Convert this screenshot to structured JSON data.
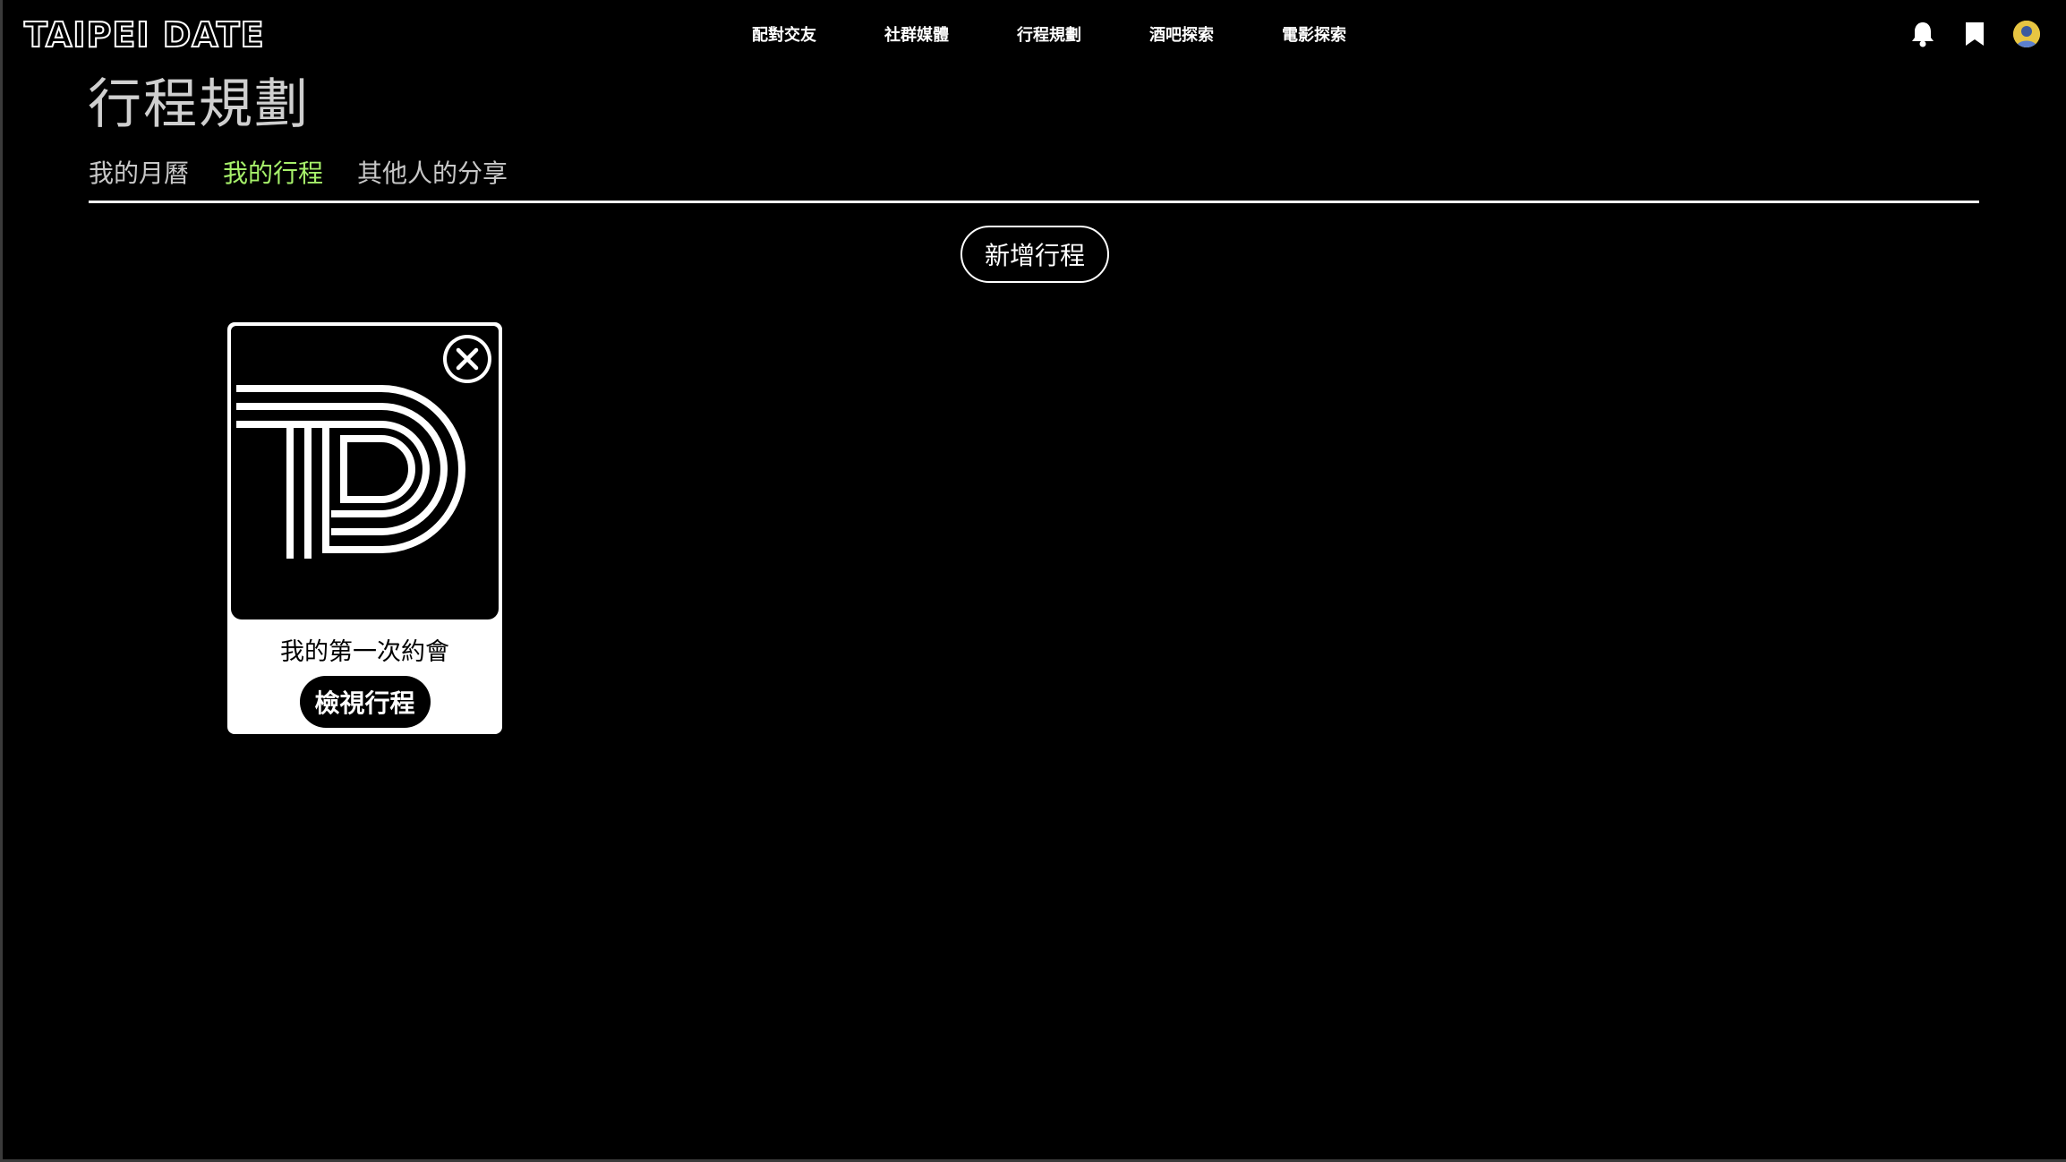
{
  "header": {
    "logo": "TAIPEI DATE",
    "nav": [
      "配對交友",
      "社群媒體",
      "行程規劃",
      "酒吧探索",
      "電影探索"
    ],
    "icons": [
      "bell-icon",
      "bookmark-icon",
      "avatar"
    ]
  },
  "page": {
    "title": "行程規劃",
    "tabs": [
      {
        "label": "我的月曆",
        "active": false
      },
      {
        "label": "我的行程",
        "active": true
      },
      {
        "label": "其他人的分享",
        "active": false
      }
    ],
    "add_button": "新增行程",
    "accent_color": "#a6f06a"
  },
  "itineraries": [
    {
      "title": "我的第一次約會",
      "view_button": "檢視行程",
      "image_icon": "td-logo-icon"
    }
  ]
}
